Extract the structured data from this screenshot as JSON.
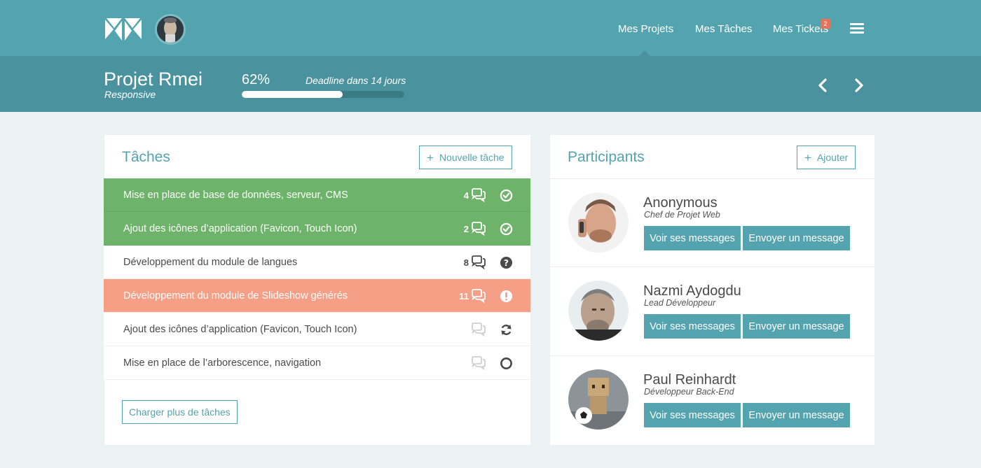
{
  "nav": {
    "items": [
      "Mes Projets",
      "Mes Tâches",
      "Mes Tickets"
    ],
    "tickets_badge": "2"
  },
  "project": {
    "title": "Projet Rmei",
    "subtitle": "Responsive",
    "progress_label": "62%",
    "progress": 0.62,
    "deadline": "Deadline dans 14 jours"
  },
  "tasks": {
    "title": "Tâches",
    "new_button": "Nouvelle tâche",
    "load_more": "Charger plus de tâches",
    "rows": [
      {
        "label": "Mise en place de base de données, serveur, CMS",
        "count": "4",
        "status": "done"
      },
      {
        "label": "Ajout des icônes d’application (Favicon, Touch Icon)",
        "count": "2",
        "status": "done"
      },
      {
        "label": "Développement du module de langues",
        "count": "8",
        "status": "question"
      },
      {
        "label": "Développement du module de Slideshow générés",
        "count": "11",
        "status": "alert"
      },
      {
        "label": "Ajout des icônes d’application (Favicon, Touch Icon)",
        "count": "",
        "status": "in-progress"
      },
      {
        "label": "Mise en place de l’arborescence, navigation",
        "count": "",
        "status": "todo"
      }
    ]
  },
  "participants": {
    "title": "Participants",
    "add_button": "Ajouter",
    "people": [
      {
        "name": "Anonymous",
        "role": "Chef de Projet Web",
        "view": "Voir ses messages",
        "send": "Envoyer un message"
      },
      {
        "name": "Nazmi Aydogdu",
        "role": "Lead Développeur",
        "view": "Voir ses messages",
        "send": "Envoyer un message"
      },
      {
        "name": "Paul Reinhardt",
        "role": "Développeur Back-End",
        "view": "Voir ses messages",
        "send": "Envoyer un message"
      }
    ]
  },
  "colors": {
    "primary": "#54a4b0",
    "primary_dark": "#4a939e",
    "done": "#6db369",
    "alert": "#f49f86",
    "background": "#ebf2f3"
  }
}
